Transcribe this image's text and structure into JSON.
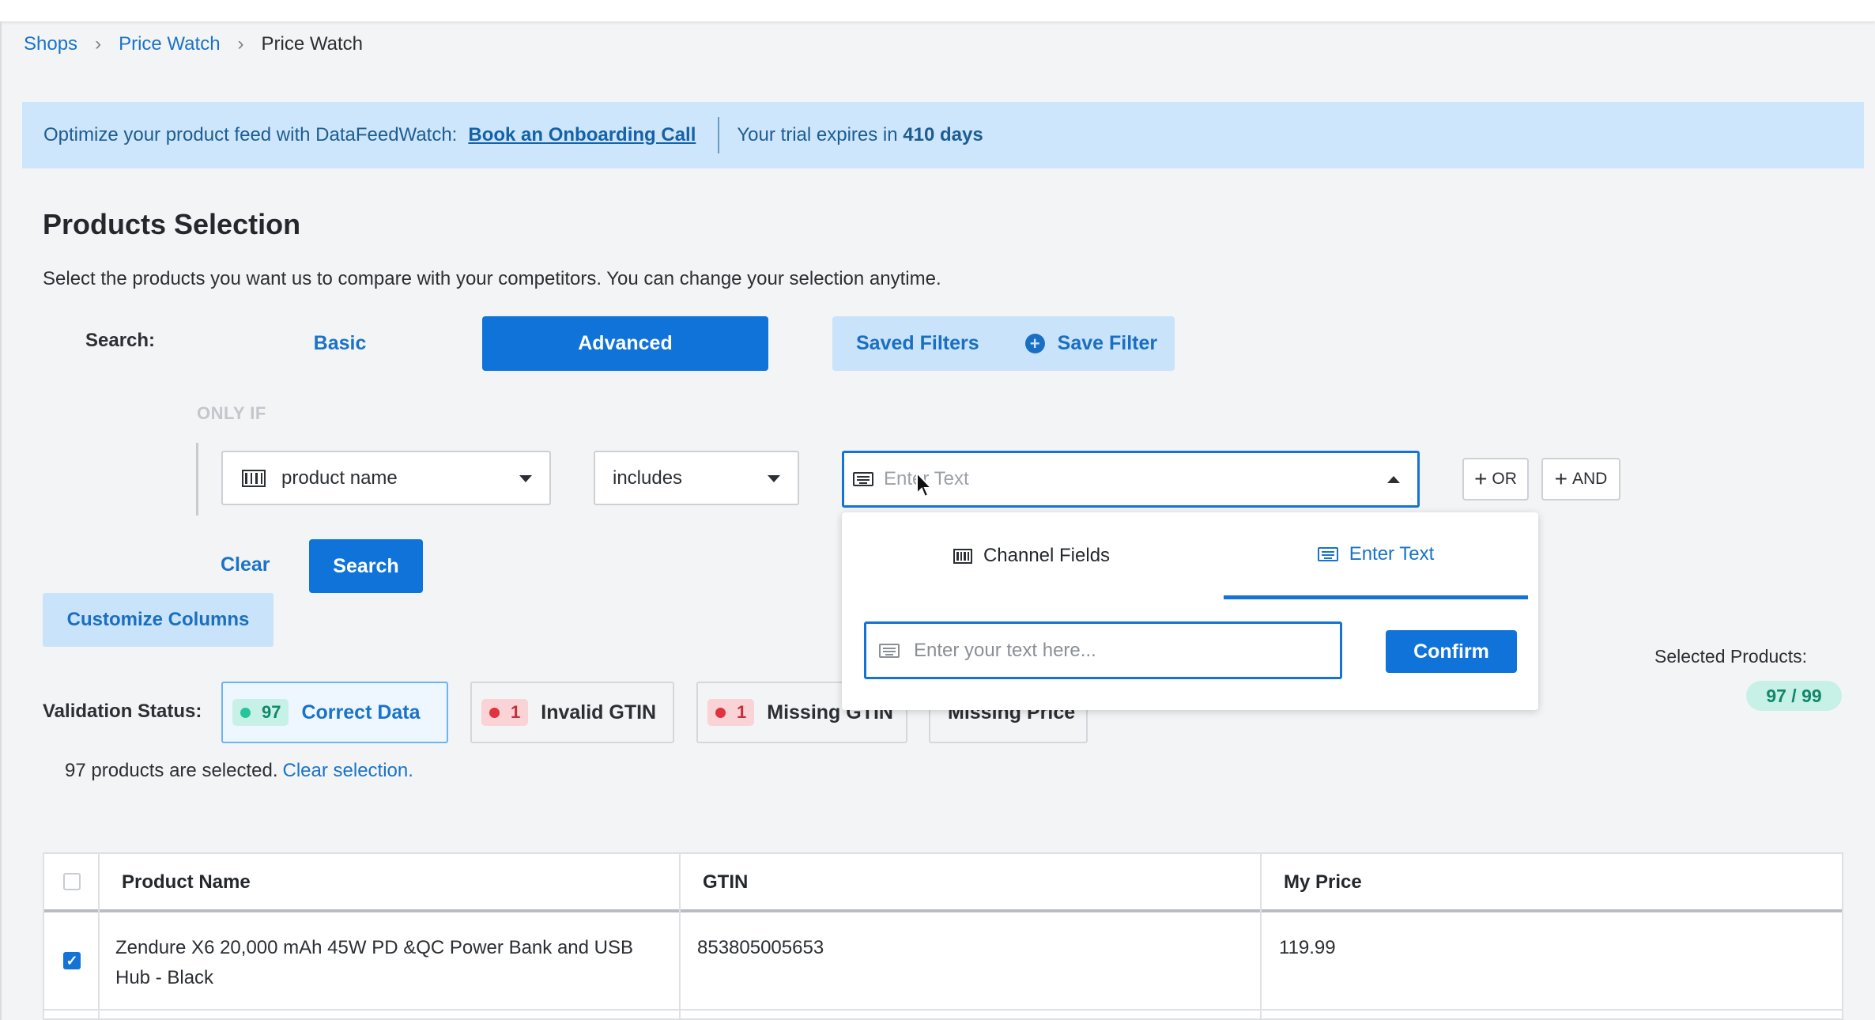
{
  "breadcrumb": {
    "items": [
      "Shops",
      "Price Watch"
    ],
    "current": "Price Watch"
  },
  "banner": {
    "promo": "Optimize your product feed with DataFeedWatch:",
    "cta": "Book an Onboarding Call",
    "trial_prefix": "Your trial expires in",
    "trial_days": "410 days"
  },
  "section": {
    "title": "Products Selection",
    "description": "Select the products you want us to compare with your competitors. You can change your selection anytime."
  },
  "search": {
    "label": "Search:",
    "basic_label": "Basic",
    "advanced_label": "Advanced",
    "saved_filters_label": "Saved Filters",
    "save_filter_label": "Save Filter",
    "only_if": "ONLY IF",
    "field_value": "product name",
    "operator_value": "includes",
    "value_placeholder": "Enter Text",
    "or_label": "OR",
    "and_label": "AND",
    "clear_label": "Clear",
    "search_label": "Search"
  },
  "dropdown": {
    "tab_channel": "Channel Fields",
    "tab_enter": "Enter Text",
    "active_tab": "Enter Text",
    "input_placeholder": "Enter your text here...",
    "confirm_label": "Confirm"
  },
  "customize_columns": "Customize Columns",
  "validation": {
    "label": "Validation Status:",
    "chips": [
      {
        "count": "97",
        "label": "Correct Data",
        "status": "green",
        "active": true
      },
      {
        "count": "1",
        "label": "Invalid GTIN",
        "status": "red"
      },
      {
        "count": "1",
        "label": "Missing GTIN",
        "status": "red"
      },
      {
        "label": "Missing Price"
      }
    ]
  },
  "selected": {
    "label": "Selected Products:",
    "value": "97 / 99"
  },
  "selection_info": {
    "text": "97 products are selected.",
    "clear_link": "Clear selection."
  },
  "table": {
    "headers": [
      "Product Name",
      "GTIN",
      "My Price"
    ],
    "rows": [
      {
        "checked": true,
        "product_name": "Zendure X6 20,000 mAh 45W PD &QC Power Bank and USB Hub - Black",
        "gtin": "853805005653",
        "price": "119.99"
      }
    ]
  },
  "colors": {
    "primary": "#0f73d9",
    "link": "#1a73c8",
    "banner_bg": "#cde6fb",
    "success": "#26c49a",
    "error": "#e0323f"
  },
  "icons": [
    "chevron-right-icon",
    "plus-circle-icon",
    "barcode-icon",
    "caret-down-icon",
    "caret-up-icon",
    "keyboard-icon",
    "plus-icon",
    "checkmark-icon",
    "mouse-pointer-icon"
  ]
}
